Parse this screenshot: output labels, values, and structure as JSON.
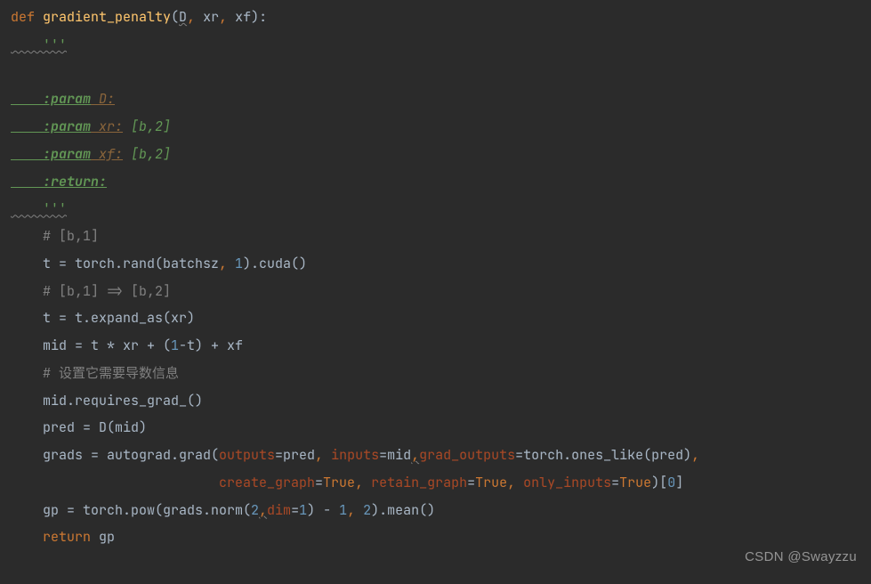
{
  "code": {
    "def_kw": "def ",
    "func_name": "gradient_penalty",
    "open_paren": "(",
    "p1": "D",
    "comma1": ", ",
    "p2": "xr",
    "comma2": ", ",
    "p3": "xf",
    "close_paren": "):",
    "docstring_open": "    '''",
    "blank1": "    ",
    "doc_p1_tag": "    :param",
    "doc_p1_name": " D:",
    "doc_p2_tag": "    :param",
    "doc_p2_name": " xr:",
    "doc_p2_desc": " [b,2]",
    "doc_p3_tag": "    :param",
    "doc_p3_name": " xf:",
    "doc_p3_desc": " [b,2]",
    "doc_ret_tag": "    :return",
    "doc_ret_colon": ":",
    "docstring_close": "    '''",
    "c1": "    # [b,1]",
    "l1_a": "    t = torch.rand(batchsz",
    "l1_comma": ", ",
    "l1_num": "1",
    "l1_b": ").cuda()",
    "c2": "    # [b,1] => [b,2]",
    "l2": "    t = t.expand_as(xr)",
    "l3_a": "    mid = t * xr + (",
    "l3_num": "1",
    "l3_b": "-t) + xf",
    "c3": "    # 设置它需要导数信息",
    "l4": "    mid.requires_grad_()",
    "l5": "    pred = D(mid)",
    "l6_a": "    grads = autograd.grad(",
    "l6_k1": "outputs",
    "l6_e1": "=pred",
    "l6_c1": ", ",
    "l6_k2": "inputs",
    "l6_e2": "=mid",
    "l6_c2": ",",
    "l6_k3": "grad_outputs",
    "l6_e3": "=torch.ones_like(pred)",
    "l6_c3": ",",
    "l7_pad": "                          ",
    "l7_k1": "create_graph",
    "l7_eq": "=",
    "l7_v1": "True",
    "l7_c1": ", ",
    "l7_k2": "retain_graph",
    "l7_v2": "True",
    "l7_c2": ", ",
    "l7_k3": "only_inputs",
    "l7_v3": "True",
    "l7_end": ")[",
    "l7_idx": "0",
    "l7_close": "]",
    "l8_a": "    gp = torch.pow(grads.norm(",
    "l8_n1": "2",
    "l8_c1": ",",
    "l8_k1": "dim",
    "l8_e1": "=",
    "l8_n2": "1",
    "l8_b": ") - ",
    "l8_n3": "1",
    "l8_c2": ", ",
    "l8_n4": "2",
    "l8_c": ").mean()",
    "ret_kw": "    return ",
    "ret_val": "gp"
  },
  "watermark": "CSDN @Swayzzu"
}
